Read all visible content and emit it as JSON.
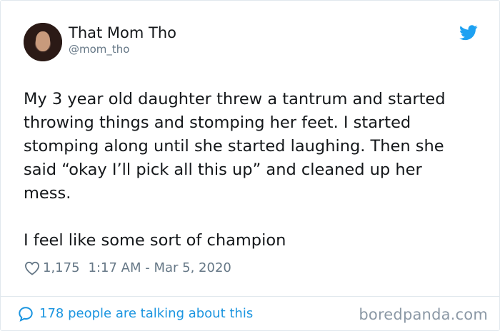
{
  "tweet": {
    "display_name": "That Mom Tho",
    "handle": "@mom_tho",
    "text": "My 3 year old daughter threw a tantrum and started\nthrowing things and stomping her feet. I started\nstomping along until she started laughing. Then she\nsaid “okay I’ll pick all this up” and cleaned up her\nmess.\n\nI feel like some sort of champion",
    "likes": "1,175",
    "timestamp": "1:17 AM - Mar 5, 2020",
    "talking": "178 people are talking about this"
  },
  "watermark": "boredpanda.com",
  "icons": {
    "brand": "twitter-bird-icon",
    "like": "heart-icon",
    "reply": "speech-bubble-icon"
  },
  "colors": {
    "accent": "#1da1f2",
    "link": "#1b95e0",
    "secondary_text": "#657786"
  }
}
